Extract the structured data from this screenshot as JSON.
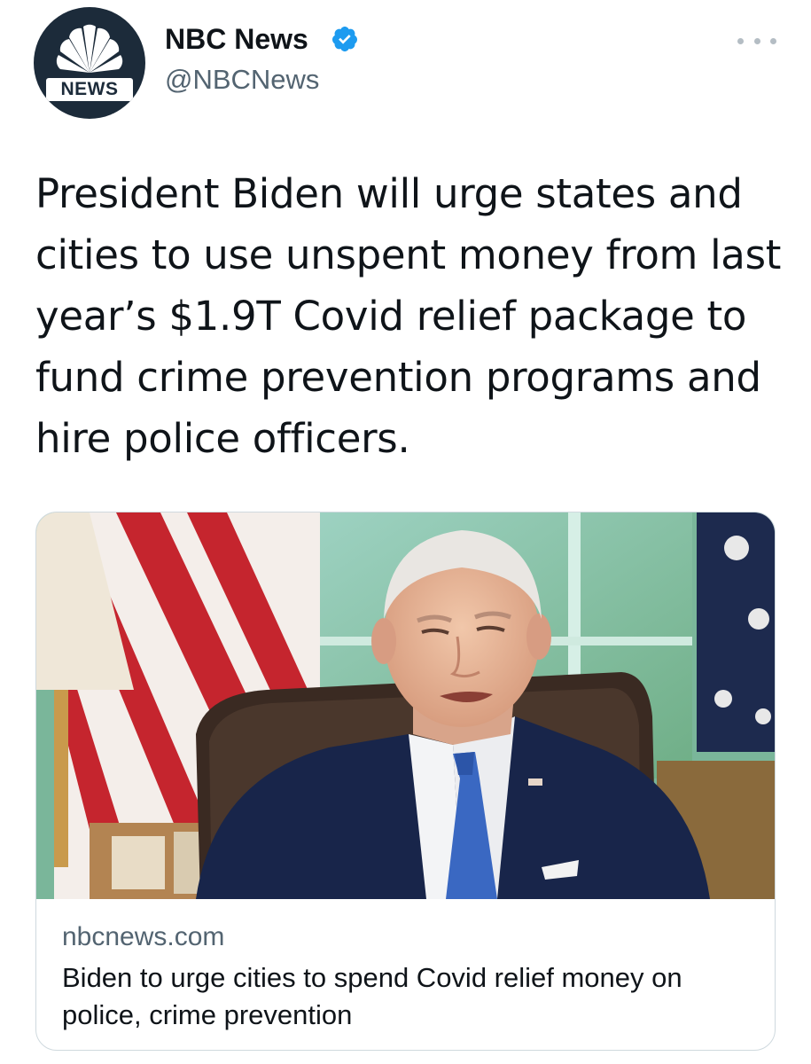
{
  "tweet": {
    "author": {
      "avatar_label": "NEWS",
      "display_name": "NBC News",
      "handle": "@NBCNews",
      "verified_icon": "verified-badge-icon",
      "verified_color": "#1d9bf0"
    },
    "more_icon": "more-options-icon",
    "text": "President Biden will urge states and cities to use unspent money from last year’s $1.9T Covid relief package to fund crime prevention programs and hire police officers."
  },
  "link_card": {
    "domain": "nbcnews.com",
    "title": "Biden to urge cities to spend Covid relief money on police, crime prevention"
  }
}
